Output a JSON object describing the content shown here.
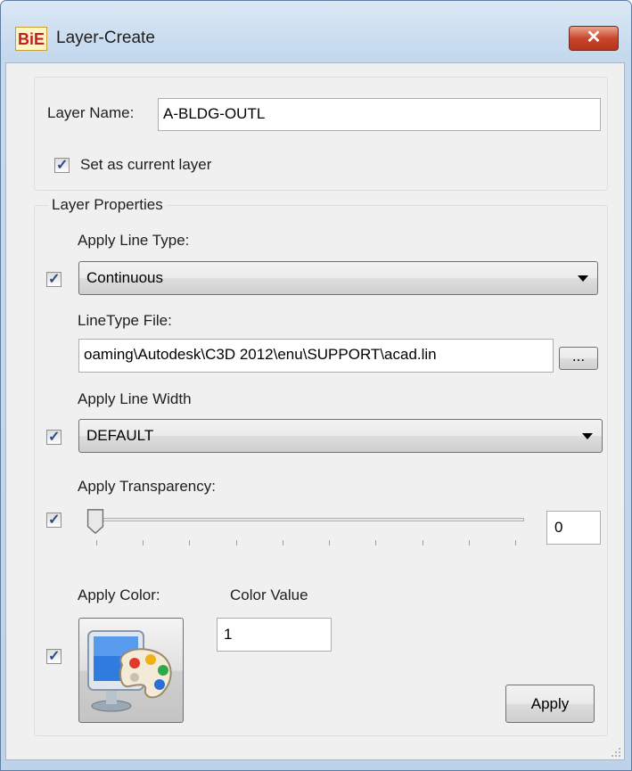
{
  "window": {
    "title": "Layer-Create",
    "app_icon_text": "BiE",
    "close_glyph": "✕"
  },
  "layer_name": {
    "label": "Layer Name:",
    "value": "A-BLDG-OUTL"
  },
  "set_current": {
    "label": "Set as current layer",
    "checked": true
  },
  "properties": {
    "legend": "Layer Properties",
    "line_type": {
      "label": "Apply Line Type:",
      "checked": true,
      "selected": "Continuous"
    },
    "linetype_file": {
      "label": "LineType File:",
      "value": "oaming\\Autodesk\\C3D 2012\\enu\\SUPPORT\\acad.lin",
      "browse_label": "..."
    },
    "line_width": {
      "label": "Apply Line Width",
      "checked": true,
      "selected": "DEFAULT"
    },
    "transparency": {
      "label": "Apply Transparency:",
      "checked": true,
      "value": "0",
      "slider_value": 0,
      "slider_min": 0,
      "slider_max": 90
    },
    "color": {
      "label": "Apply Color:",
      "checked": true,
      "value_label": "Color Value",
      "value": "1",
      "icon": "color-palette-monitor-icon"
    }
  },
  "apply_button": "Apply",
  "colors": {
    "title_bar": "#c5d9ee",
    "close_button": "#c8472c",
    "check_mark": "#2b4a8c",
    "dialog_bg": "#f0f0f0"
  }
}
